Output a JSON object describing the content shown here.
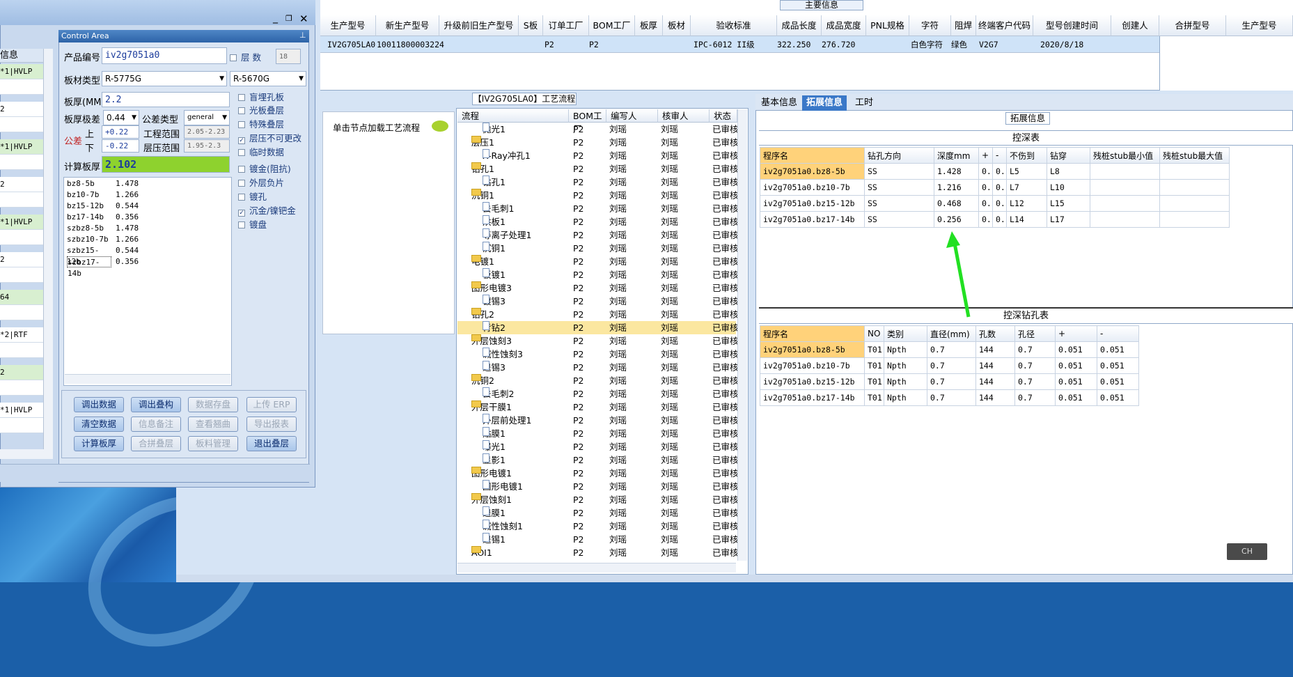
{
  "desktop": {
    "ime_label": "CH"
  },
  "top": {
    "group_header": "主要信息",
    "columns": [
      "生产型号",
      "新生产型号",
      "升级前旧生产型号",
      "S板",
      "订单工厂",
      "BOM工厂",
      "板厚",
      "板材",
      "验收标准",
      "成品长度",
      "成品宽度",
      "PNL规格",
      "字符",
      "阻焊",
      "终端客户代码",
      "型号创建时间",
      "创建人"
    ],
    "row": {
      "prod_model": "IV2G705LA0",
      "new_model": "10011800003224",
      "order_factory": "P2",
      "bom_factory": "P2",
      "standard": "IPC-6012 II级",
      "length": "322.250",
      "width": "276.720",
      "char": "白色字符",
      "solder": "绿色",
      "customer": "V2G7",
      "created": "2020/8/18"
    },
    "side_columns": [
      "合拼型号",
      "生产型号"
    ]
  },
  "left": {
    "title": "信息",
    "rows": [
      "*1|HVLP",
      "2",
      "*1|HVLP",
      "2",
      "*1|HVLP",
      "2",
      "64",
      "*2|RTF",
      "2",
      "*1|HVLP"
    ]
  },
  "control": {
    "title": "Control Area",
    "pin": "⊥",
    "product_label": "产品编号",
    "product_value": "iv2g7051a0",
    "layers_label": "层 数",
    "layers_value": "18",
    "board_type_label": "板材类型",
    "board_type_value": "R-5775G",
    "board_type_value2": "R-5670G",
    "thickness_label": "板厚(MM)",
    "thickness_value": "2.2",
    "tol_label": "板厚极差",
    "tol_value": "0.44",
    "tol_type_label": "公差类型",
    "tol_type_value": "general",
    "gongcha": "公差",
    "up": "上",
    "down": "下",
    "up_value": "+0.22",
    "down_value": "-0.22",
    "eng_range_label": "工程范围",
    "eng_range_value": "2.05-2.23",
    "layer_range_label": "层压范围",
    "layer_range_value": "1.95-2.3",
    "calc_label": "计算板厚",
    "calc_value": "2.102",
    "checks": [
      {
        "label": "盲埋孔板",
        "checked": false
      },
      {
        "label": "光板叠层",
        "checked": false
      },
      {
        "label": "特殊叠层",
        "checked": false
      },
      {
        "label": "层压不可更改",
        "checked": true
      },
      {
        "label": "临时数据",
        "checked": false
      },
      {
        "label": "镀金(阻抗)",
        "checked": false
      },
      {
        "label": "外层负片",
        "checked": false
      },
      {
        "label": "镀孔",
        "checked": false
      },
      {
        "label": "沉金/镍钯金",
        "checked": true
      },
      {
        "label": "镀盘",
        "checked": false
      }
    ],
    "list": [
      [
        "bz8-5b",
        "1.478"
      ],
      [
        "bz10-7b",
        "1.266"
      ],
      [
        "bz15-12b",
        "0.544"
      ],
      [
        "bz17-14b",
        "0.356"
      ],
      [
        "szbz8-5b",
        "1.478"
      ],
      [
        "szbz10-7b",
        "1.266"
      ],
      [
        "szbz15-12b",
        "0.544"
      ],
      [
        "szbz17-14b",
        "0.356"
      ]
    ],
    "buttons": [
      [
        "调出数据",
        "调出叠构",
        "数据存盘",
        "上传 ERP"
      ],
      [
        "清空数据",
        "信息备注",
        "查看翘曲",
        "导出报表"
      ],
      [
        "计算板厚",
        "合拼叠层",
        "板料管理",
        "退出叠层"
      ]
    ],
    "buttons_enabled": [
      [
        true,
        true,
        false,
        false
      ],
      [
        true,
        false,
        false,
        false
      ],
      [
        true,
        false,
        false,
        true
      ]
    ]
  },
  "flow": {
    "header": "【IV2G705LA0】工艺流程",
    "hint": "单击节点加载工艺流程",
    "columns": [
      "流程",
      "BOM工厂",
      "编写人",
      "核审人",
      "状态"
    ],
    "rows": [
      {
        "level": 1,
        "name": "抛光1",
        "f": "P2",
        "w": "刘瑶",
        "r": "刘瑶",
        "s": "已审核"
      },
      {
        "level": 0,
        "name": "层压1",
        "f": "P2",
        "w": "刘瑶",
        "r": "刘瑶",
        "s": "已审核"
      },
      {
        "level": 1,
        "name": "X-Ray冲孔1",
        "f": "P2",
        "w": "刘瑶",
        "r": "刘瑶",
        "s": "已审核"
      },
      {
        "level": 0,
        "name": "钻孔1",
        "f": "P2",
        "w": "刘瑶",
        "r": "刘瑶",
        "s": "已审核"
      },
      {
        "level": 1,
        "name": "钻孔1",
        "f": "P2",
        "w": "刘瑶",
        "r": "刘瑶",
        "s": "已审核"
      },
      {
        "level": 0,
        "name": "沉铜1",
        "f": "P2",
        "w": "刘瑶",
        "r": "刘瑶",
        "s": "已审核"
      },
      {
        "level": 1,
        "name": "去毛刺1",
        "f": "P2",
        "w": "刘瑶",
        "r": "刘瑶",
        "s": "已审核"
      },
      {
        "level": 1,
        "name": "烘板1",
        "f": "P2",
        "w": "刘瑶",
        "r": "刘瑶",
        "s": "已审核"
      },
      {
        "level": 1,
        "name": "等离子处理1",
        "f": "P2",
        "w": "刘瑶",
        "r": "刘瑶",
        "s": "已审核"
      },
      {
        "level": 1,
        "name": "沉铜1",
        "f": "P2",
        "w": "刘瑶",
        "r": "刘瑶",
        "s": "已审核"
      },
      {
        "level": 0,
        "name": "电镀1",
        "f": "P2",
        "w": "刘瑶",
        "r": "刘瑶",
        "s": "已审核"
      },
      {
        "level": 1,
        "name": "板镀1",
        "f": "P2",
        "w": "刘瑶",
        "r": "刘瑶",
        "s": "已审核"
      },
      {
        "level": 0,
        "name": "图形电镀3",
        "f": "P2",
        "w": "刘瑶",
        "r": "刘瑶",
        "s": "已审核"
      },
      {
        "level": 1,
        "name": "镀锡3",
        "f": "P2",
        "w": "刘瑶",
        "r": "刘瑶",
        "s": "已审核"
      },
      {
        "level": 0,
        "name": "钻孔2",
        "f": "P2",
        "w": "刘瑶",
        "r": "刘瑶",
        "s": "已审核"
      },
      {
        "level": 1,
        "name": "背钻2",
        "f": "P2",
        "w": "刘瑶",
        "r": "刘瑶",
        "s": "已审核",
        "sel": true
      },
      {
        "level": 0,
        "name": "外层蚀刻3",
        "f": "P2",
        "w": "刘瑶",
        "r": "刘瑶",
        "s": "已审核"
      },
      {
        "level": 1,
        "name": "碱性蚀刻3",
        "f": "P2",
        "w": "刘瑶",
        "r": "刘瑶",
        "s": "已审核"
      },
      {
        "level": 1,
        "name": "退锡3",
        "f": "P2",
        "w": "刘瑶",
        "r": "刘瑶",
        "s": "已审核"
      },
      {
        "level": 0,
        "name": "沉铜2",
        "f": "P2",
        "w": "刘瑶",
        "r": "刘瑶",
        "s": "已审核"
      },
      {
        "level": 1,
        "name": "去毛刺2",
        "f": "P2",
        "w": "刘瑶",
        "r": "刘瑶",
        "s": "已审核"
      },
      {
        "level": 0,
        "name": "外层干膜1",
        "f": "P2",
        "w": "刘瑶",
        "r": "刘瑶",
        "s": "已审核"
      },
      {
        "level": 1,
        "name": "外层前处理1",
        "f": "P2",
        "w": "刘瑶",
        "r": "刘瑶",
        "s": "已审核"
      },
      {
        "level": 1,
        "name": "贴膜1",
        "f": "P2",
        "w": "刘瑶",
        "r": "刘瑶",
        "s": "已审核"
      },
      {
        "level": 1,
        "name": "曝光1",
        "f": "P2",
        "w": "刘瑶",
        "r": "刘瑶",
        "s": "已审核"
      },
      {
        "level": 1,
        "name": "显影1",
        "f": "P2",
        "w": "刘瑶",
        "r": "刘瑶",
        "s": "已审核"
      },
      {
        "level": 0,
        "name": "图形电镀1",
        "f": "P2",
        "w": "刘瑶",
        "r": "刘瑶",
        "s": "已审核"
      },
      {
        "level": 1,
        "name": "图形电镀1",
        "f": "P2",
        "w": "刘瑶",
        "r": "刘瑶",
        "s": "已审核"
      },
      {
        "level": 0,
        "name": "外层蚀刻1",
        "f": "P2",
        "w": "刘瑶",
        "r": "刘瑶",
        "s": "已审核"
      },
      {
        "level": 1,
        "name": "退膜1",
        "f": "P2",
        "w": "刘瑶",
        "r": "刘瑶",
        "s": "已审核"
      },
      {
        "level": 1,
        "name": "碱性蚀刻1",
        "f": "P2",
        "w": "刘瑶",
        "r": "刘瑶",
        "s": "已审核"
      },
      {
        "level": 1,
        "name": "退锡1",
        "f": "P2",
        "w": "刘瑶",
        "r": "刘瑶",
        "s": "已审核"
      },
      {
        "level": 0,
        "name": "AOI1",
        "f": "P2",
        "w": "刘瑶",
        "r": "刘瑶",
        "s": "已审核"
      }
    ]
  },
  "right": {
    "tabs": [
      "基本信息",
      "拓展信息",
      "工时"
    ],
    "active_tab": 1,
    "section_label": "拓展信息",
    "depth_title": "控深表",
    "depth_cols": [
      "程序名",
      "钻孔方向",
      "深度mm",
      "+",
      "-",
      "不伤到",
      "钻穿",
      "残桩stub最小值",
      "残桩stub最大值"
    ],
    "depth_rows": [
      [
        "iv2g7051a0.bz8-5b",
        "SS",
        "1.428",
        "0.",
        "0.",
        "L5",
        "L8",
        "",
        ""
      ],
      [
        "iv2g7051a0.bz10-7b",
        "SS",
        "1.216",
        "0.",
        "0.",
        "L7",
        "L10",
        "",
        ""
      ],
      [
        "iv2g7051a0.bz15-12b",
        "SS",
        "0.468",
        "0.",
        "0.",
        "L12",
        "L15",
        "",
        ""
      ],
      [
        "iv2g7051a0.bz17-14b",
        "SS",
        "0.256",
        "0.",
        "0.",
        "L14",
        "L17",
        "",
        ""
      ]
    ],
    "drill_title": "控深钻孔表",
    "drill_cols": [
      "程序名",
      "NO",
      "类别",
      "直径(mm)",
      "孔数",
      "孔径",
      "+",
      "-"
    ],
    "drill_rows": [
      [
        "iv2g7051a0.bz8-5b",
        "T01",
        "Npth",
        "0.7",
        "144",
        "0.7",
        "0.051",
        "0.051"
      ],
      [
        "iv2g7051a0.bz10-7b",
        "T01",
        "Npth",
        "0.7",
        "144",
        "0.7",
        "0.051",
        "0.051"
      ],
      [
        "iv2g7051a0.bz15-12b",
        "T01",
        "Npth",
        "0.7",
        "144",
        "0.7",
        "0.051",
        "0.051"
      ],
      [
        "iv2g7051a0.bz17-14b",
        "T01",
        "Npth",
        "0.7",
        "144",
        "0.7",
        "0.051",
        "0.051"
      ]
    ]
  }
}
